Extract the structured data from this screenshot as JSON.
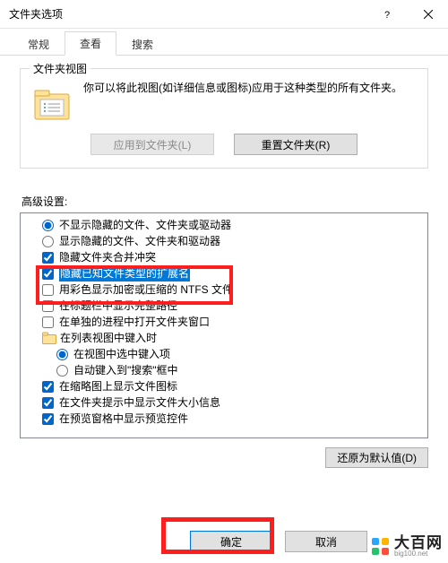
{
  "window": {
    "title": "文件夹选项"
  },
  "tabs": {
    "general": "常规",
    "view": "查看",
    "search": "搜索"
  },
  "folder_views": {
    "group_title": "文件夹视图",
    "description": "你可以将此视图(如详细信息或图标)应用于这种类型的所有文件夹。",
    "apply_to_folders": "应用到文件夹(L)",
    "reset_folders": "重置文件夹(R)"
  },
  "advanced": {
    "label": "高级设置:",
    "items": [
      {
        "type": "radio",
        "indent": 0,
        "checked": true,
        "label": "不显示隐藏的文件、文件夹或驱动器"
      },
      {
        "type": "radio",
        "indent": 0,
        "checked": false,
        "label": "显示隐藏的文件、文件夹和驱动器"
      },
      {
        "type": "checkbox",
        "indent": 0,
        "checked": true,
        "label": "隐藏文件夹合并冲突",
        "strike": true
      },
      {
        "type": "checkbox",
        "indent": 0,
        "checked": true,
        "label": "隐藏已知文件类型的扩展名",
        "highlight": true
      },
      {
        "type": "checkbox",
        "indent": 0,
        "checked": false,
        "label": "用彩色显示加密或压缩的 NTFS 文件",
        "strike": true
      },
      {
        "type": "checkbox",
        "indent": 0,
        "checked": false,
        "label": "在标题栏中显示完整路径"
      },
      {
        "type": "checkbox",
        "indent": 0,
        "checked": false,
        "label": "在单独的进程中打开文件夹窗口"
      },
      {
        "type": "folder",
        "indent": 0,
        "label": "在列表视图中键入时"
      },
      {
        "type": "radio",
        "indent": 1,
        "checked": true,
        "label": "在视图中选中键入项"
      },
      {
        "type": "radio",
        "indent": 1,
        "checked": false,
        "label": "自动键入到\"搜索\"框中"
      },
      {
        "type": "checkbox",
        "indent": 0,
        "checked": true,
        "label": "在缩略图上显示文件图标"
      },
      {
        "type": "checkbox",
        "indent": 0,
        "checked": true,
        "label": "在文件夹提示中显示文件大小信息"
      },
      {
        "type": "checkbox",
        "indent": 0,
        "checked": true,
        "label": "在预览窗格中显示预览控件"
      }
    ]
  },
  "buttons": {
    "restore_defaults": "还原为默认值(D)",
    "ok": "确定",
    "cancel": "取消"
  },
  "watermark": {
    "cn": "大百网",
    "en": "big100.net"
  }
}
